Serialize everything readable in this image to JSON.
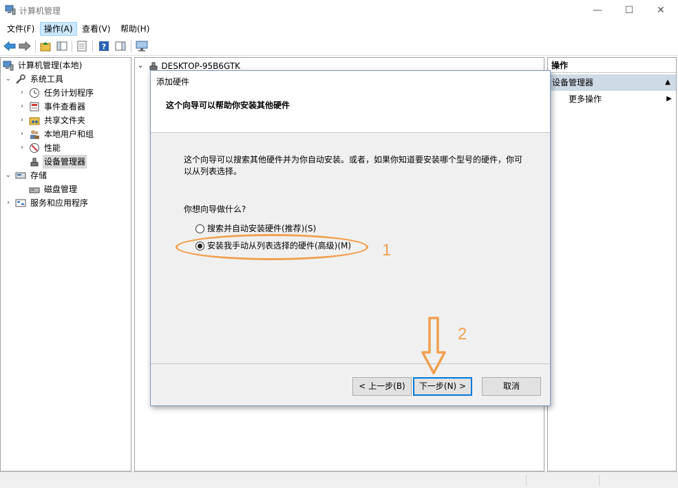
{
  "window": {
    "title": "计算机管理",
    "minimize_symbol": "—",
    "maximize_symbol": "☐",
    "close_symbol": "✕"
  },
  "menu": {
    "items": [
      "文件(F)",
      "操作(A)",
      "查看(V)",
      "帮助(H)"
    ],
    "active_index": 1
  },
  "toolbar": {
    "icons": [
      "back-arrow-icon",
      "forward-arrow-icon",
      "up-folder-icon",
      "show-hide-tree-icon",
      "properties-icon",
      "help-icon",
      "show-hide-action-pane-icon",
      "monitor-icon"
    ]
  },
  "tree": {
    "root": "计算机管理(本地)",
    "system_tools": "系统工具",
    "task_scheduler": "任务计划程序",
    "event_viewer": "事件查看器",
    "shared_folders": "共享文件夹",
    "local_users_groups": "本地用户和组",
    "performance": "性能",
    "device_manager": "设备管理器",
    "storage": "存储",
    "disk_management": "磁盘管理",
    "services_apps": "服务和应用程序"
  },
  "center": {
    "computer_name": "DESKTOP-95B6GTK"
  },
  "actions": {
    "header": "操作",
    "group": "设备管理器",
    "more": "更多操作"
  },
  "wizard": {
    "title": "添加硬件",
    "heading": "这个向导可以帮助你安装其他硬件",
    "description": "这个向导可以搜索其他硬件并为你自动安装。或者，如果你知道要安装哪个型号的硬件，你可以从列表选择。",
    "question": "你想向导做什么?",
    "option_auto": "搜索并自动安装硬件(推荐)(S)",
    "option_manual": "安装我手动从列表选择的硬件(高级)(M)",
    "selected_option": "manual",
    "back_button": "< 上一步(B)",
    "next_button": "下一步(N) >",
    "cancel_button": "取消"
  },
  "annotations": {
    "step1": "1",
    "step2": "2",
    "color": "#f0a050"
  },
  "colors": {
    "selection_blue": "#cce8ff",
    "actions_group_bg": "#cfdae7",
    "default_button_border": "#0078d7"
  }
}
